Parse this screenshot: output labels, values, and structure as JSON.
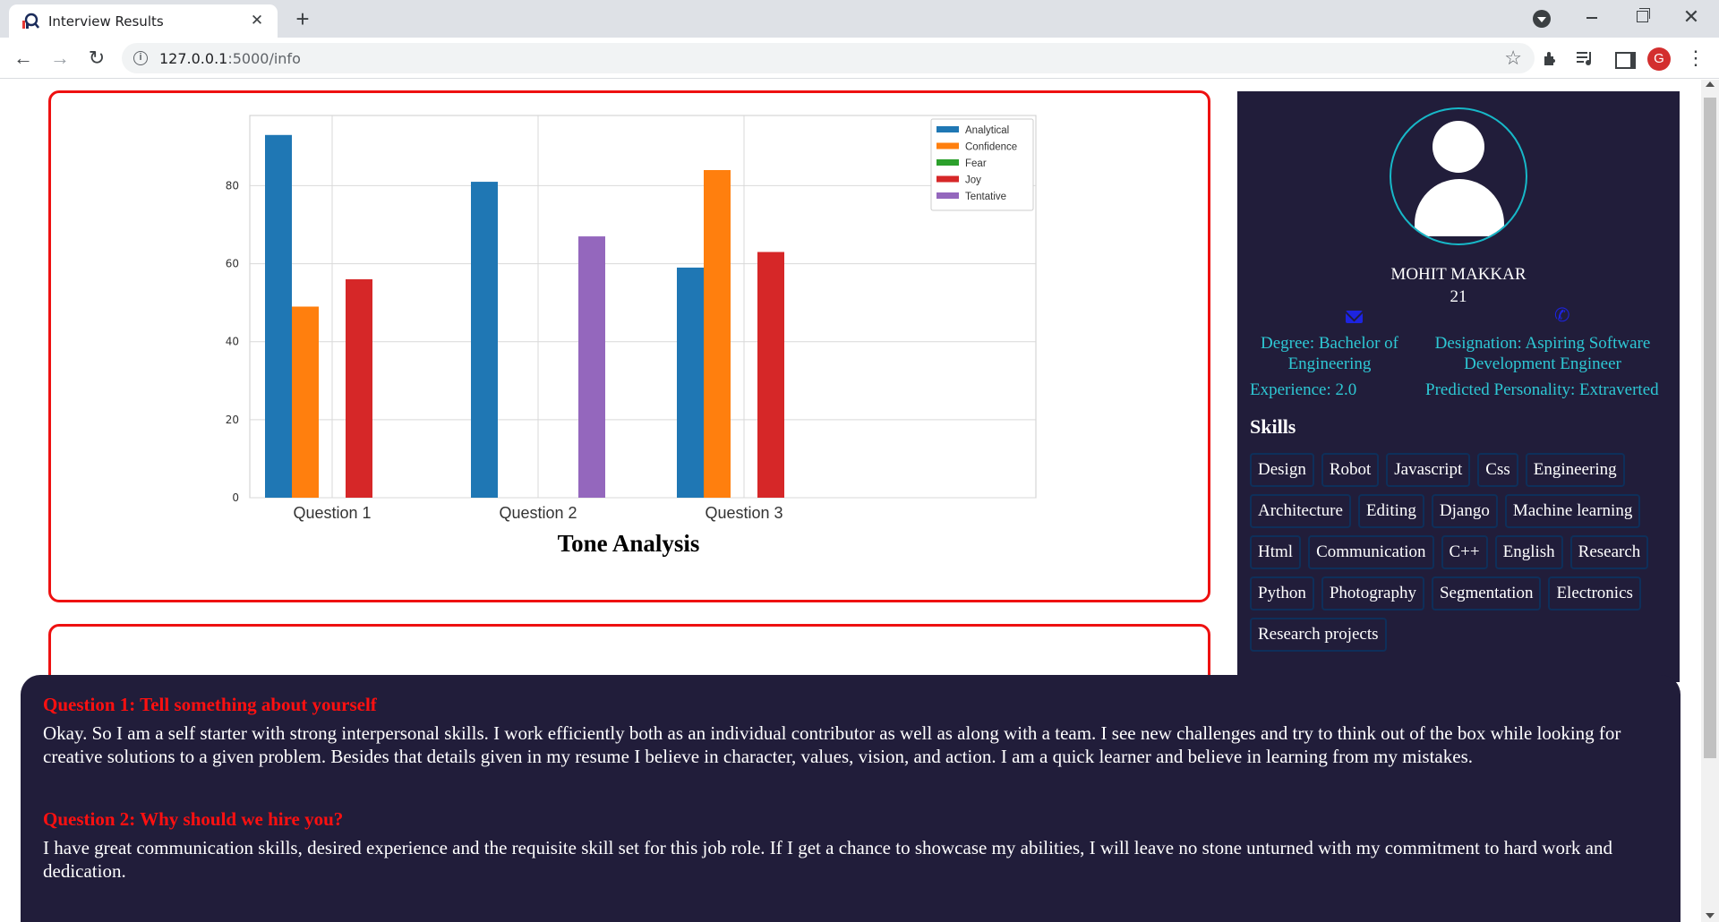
{
  "browser": {
    "tab_title": "Interview Results",
    "url_host": "127.0.0.1",
    "url_path": ":5000/info",
    "profile_initial": "G"
  },
  "chart_data": {
    "type": "bar",
    "title": "Tone Analysis",
    "categories": [
      "Question 1",
      "Question 2",
      "Question 3"
    ],
    "series": [
      {
        "name": "Analytical",
        "color": "#1f77b4",
        "values": [
          93,
          81,
          59
        ]
      },
      {
        "name": "Confidence",
        "color": "#ff7f0e",
        "values": [
          49,
          0,
          84
        ]
      },
      {
        "name": "Fear",
        "color": "#2ca02c",
        "values": [
          0,
          0,
          0
        ]
      },
      {
        "name": "Joy",
        "color": "#d62728",
        "values": [
          56,
          0,
          63
        ]
      },
      {
        "name": "Tentative",
        "color": "#9467bd",
        "values": [
          0,
          67,
          0
        ]
      }
    ],
    "yticks": [
      0,
      20,
      40,
      60,
      80
    ],
    "ylim": [
      0,
      98
    ],
    "grid": true,
    "legend": "top-right"
  },
  "profile": {
    "name": "MOHIT MAKKAR",
    "age": "21",
    "degree": "Degree: Bachelor of Engineering",
    "designation": "Designation: Aspiring Software Development Engineer",
    "experience": "Experience: 2.0",
    "personality": "Predicted Personality: Extraverted",
    "skills_title": "Skills",
    "skills": [
      "Design",
      "Robot",
      "Javascript",
      "Css",
      "Engineering",
      "Architecture",
      "Editing",
      "Django",
      "Machine learning",
      "Html",
      "Communication",
      "C++",
      "English",
      "Research",
      "Python",
      "Photography",
      "Segmentation",
      "Electronics",
      "Research projects"
    ],
    "accent": "#2ec8d4",
    "panel_color": "#211d3a"
  },
  "questions": [
    {
      "title": "Question 1: Tell something about yourself",
      "answer": "Okay. So I am a self starter with strong interpersonal skills. I work efficiently both as an individual contributor as well as along with a team. I see new challenges and try to think out of the box while looking for creative solutions to a given problem. Besides that details given in my resume I believe in character, values, vision, and action. I am a quick learner and believe in learning from my mistakes."
    },
    {
      "title": "Question 2: Why should we hire you?",
      "answer": "I have great communication skills, desired experience and the requisite skill set for this job role. If I get a chance to showcase my abilities, I will leave no stone unturned with my commitment to hard work and dedication."
    }
  ]
}
